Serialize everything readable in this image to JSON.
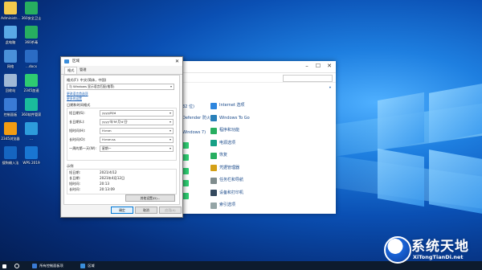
{
  "desktop": {
    "icons": [
      {
        "label": "Administr...",
        "color": "#f2c94c"
      },
      {
        "label": "360安全卫士",
        "color": "#27ae60"
      },
      {
        "label": "此电脑",
        "color": "#5aa9e6"
      },
      {
        "label": "360杀毒",
        "color": "#27ae60"
      },
      {
        "label": "网络",
        "color": "#4a90d9"
      },
      {
        "label": "...docx",
        "color": "#2b6cc4"
      },
      {
        "label": "回收站",
        "color": "#9fb8d6"
      },
      {
        "label": "2345加速",
        "color": "#2ecc71"
      },
      {
        "label": "控制面板",
        "color": "#3a7bd5"
      },
      {
        "label": "360软件管家",
        "color": "#1abc9c"
      },
      {
        "label": "2345浏览器",
        "color": "#f39c12"
      },
      {
        "label": "...",
        "color": "#2d9cdb"
      },
      {
        "label": "搜狗输入法",
        "color": "#1565c0"
      },
      {
        "label": "WPS 2019",
        "color": "#1976d2"
      }
    ]
  },
  "control_panel": {
    "items_right": [
      {
        "label": "Internet 选项",
        "color": "#2e86de"
      },
      {
        "label": "Windows To Go",
        "color": "#2980b9"
      },
      {
        "label": "程序和功能",
        "color": "#27ae60"
      },
      {
        "label": "电源选项",
        "color": "#16a085"
      },
      {
        "label": "恢复",
        "color": "#27ae60"
      },
      {
        "label": "凭据管理器",
        "color": "#d4a017"
      },
      {
        "label": "任务栏和导航",
        "color": "#7f8c8d"
      },
      {
        "label": "设备和打印机",
        "color": "#34495e"
      },
      {
        "label": "索引选项",
        "color": "#95a5a6"
      }
    ],
    "items_left": [
      {
        "label": "32 位)"
      },
      {
        "label": "Defender 防火"
      },
      {
        "label": "Windows 7)"
      }
    ]
  },
  "dialog": {
    "title": "区域",
    "tabs": [
      "格式",
      "管理"
    ],
    "format_label": "格式(F): 中文(简体，中国)",
    "format_value": "与 Windows 显示语言匹配(推荐)",
    "link_language": "更改语言首选项",
    "link_formats": "更多的设置",
    "date_time_header": "日期和时间格式",
    "fields": [
      {
        "label": "短日期(S):",
        "value": "yyyy/M/d"
      },
      {
        "label": "长日期(L):",
        "value": "yyyy'年'M'月'd'日'"
      },
      {
        "label": "短时间(H):",
        "value": "H:mm"
      },
      {
        "label": "长时间(O):",
        "value": "H:mm:ss"
      },
      {
        "label": "一周的第一天(W):",
        "value": "星期一"
      }
    ],
    "examples_header": "示例",
    "examples": [
      {
        "label": "短日期:",
        "value": "2021/4/12"
      },
      {
        "label": "长日期:",
        "value": "2021年4月12日"
      },
      {
        "label": "短时间:",
        "value": "20:13"
      },
      {
        "label": "长时间:",
        "value": "20:13:09"
      }
    ],
    "other_settings": "其他设置(D)...",
    "ok": "确定",
    "cancel": "取消",
    "apply": "应用(A)"
  },
  "taskbar": {
    "items": [
      {
        "label": "所有控制面板项"
      },
      {
        "label": "区域"
      }
    ]
  },
  "watermark": {
    "title": "系统天地",
    "url": "XiTongTianDi.net"
  }
}
